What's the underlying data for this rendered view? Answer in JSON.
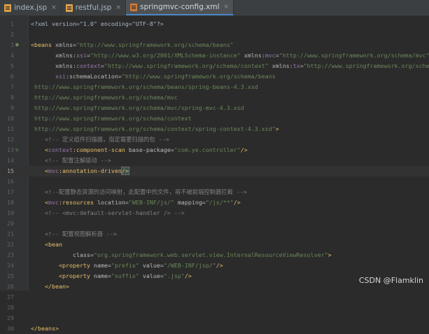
{
  "tabs": [
    {
      "label": "index.jsp",
      "active": false,
      "icon": "jsp-file-icon"
    },
    {
      "label": "restful.jsp",
      "active": false,
      "icon": "jsp-file-icon"
    },
    {
      "label": "springmvc-config.xml",
      "active": true,
      "icon": "xml-file-icon"
    }
  ],
  "close_glyph": "×",
  "current_line": 15,
  "lines": [
    {
      "n": "1",
      "tokens": [
        [
          "t-plain",
          "<?xml version=\"1.0\" encoding=\"UTF-8\"?>"
        ]
      ]
    },
    {
      "n": "2",
      "tokens": []
    },
    {
      "n": "3",
      "mark": "●",
      "tokens": [
        [
          "t-tag",
          "<beans "
        ],
        [
          "t-attr",
          "xmlns="
        ],
        [
          "t-val",
          "\"http://www.springframework.org/schema/beans\""
        ]
      ]
    },
    {
      "n": "4",
      "tokens": [
        [
          "t-plain",
          "       "
        ],
        [
          "t-attr",
          "xmlns:"
        ],
        [
          "t-ns",
          "xsi"
        ],
        [
          "t-attr",
          "="
        ],
        [
          "t-val",
          "\"http://www.w3.org/2001/XMLSchema-instance\""
        ],
        [
          "t-plain",
          " "
        ],
        [
          "t-attr",
          "xmlns:"
        ],
        [
          "t-ns",
          "mvc"
        ],
        [
          "t-attr",
          "="
        ],
        [
          "t-val",
          "\"http://www.springframework.org/schema/mvc\""
        ]
      ]
    },
    {
      "n": "5",
      "tokens": [
        [
          "t-plain",
          "       "
        ],
        [
          "t-attr",
          "xmlns:"
        ],
        [
          "t-ns",
          "context"
        ],
        [
          "t-attr",
          "="
        ],
        [
          "t-val",
          "\"http://www.springframework.org/schema/context\""
        ],
        [
          "t-plain",
          " "
        ],
        [
          "t-attr",
          "xmlns:"
        ],
        [
          "t-ns",
          "tx"
        ],
        [
          "t-attr",
          "="
        ],
        [
          "t-val",
          "\"http://www.springframework.org/schema/tx\""
        ]
      ]
    },
    {
      "n": "6",
      "tokens": [
        [
          "t-plain",
          "       "
        ],
        [
          "t-ns",
          "xsi"
        ],
        [
          "t-attr",
          ":schemaLocation="
        ],
        [
          "t-val",
          "\"http://www.springframework.org/schema/beans"
        ]
      ]
    },
    {
      "n": "7",
      "tokens": [
        [
          "t-val",
          " http://www.springframework.org/schema/beans/spring-beans-4.3.xsd"
        ]
      ]
    },
    {
      "n": "8",
      "tokens": [
        [
          "t-val",
          " http://www.springframework.org/schema/mvc"
        ]
      ]
    },
    {
      "n": "9",
      "tokens": [
        [
          "t-val",
          " http://www.springframework.org/schema/mvc/spring-mvc-4.3.xsd"
        ]
      ]
    },
    {
      "n": "10",
      "tokens": [
        [
          "t-val",
          " http://www.springframework.org/schema/context"
        ]
      ]
    },
    {
      "n": "11",
      "tokens": [
        [
          "t-val",
          " http://www.springframework.org/schema/context/spring-context-4.3.xsd\""
        ],
        [
          "t-tag",
          ">"
        ]
      ]
    },
    {
      "n": "12",
      "tokens": [
        [
          "t-cmt",
          "    <!-- 定义组件扫描器，指定需要扫描的包 -->"
        ]
      ]
    },
    {
      "n": "13",
      "mark": "↻",
      "tokens": [
        [
          "t-plain",
          "    "
        ],
        [
          "t-tag",
          "<"
        ],
        [
          "t-ns",
          "context"
        ],
        [
          "t-tag",
          ":component-scan "
        ],
        [
          "t-attr",
          "base-package="
        ],
        [
          "t-val",
          "\"com.ye.controller\""
        ],
        [
          "t-tag",
          "/>"
        ]
      ]
    },
    {
      "n": "14",
      "tokens": [
        [
          "t-cmt",
          "    <!-- 配置注解驱动 -->"
        ]
      ]
    },
    {
      "n": "15",
      "tokens": [
        [
          "t-plain",
          "    "
        ],
        [
          "t-tag",
          "<"
        ],
        [
          "t-ns",
          "mvc"
        ],
        [
          "t-tag",
          ":annotation-driven"
        ],
        [
          "t-tag hl",
          "/>"
        ]
      ]
    },
    {
      "n": "16",
      "tokens": []
    },
    {
      "n": "17",
      "tokens": [
        [
          "t-cmt",
          "    <!--配置静态资源的访问映射，此配置中的文件，将不被前端控制器拦截 -->"
        ]
      ]
    },
    {
      "n": "18",
      "tokens": [
        [
          "t-plain",
          "    "
        ],
        [
          "t-tag",
          "<"
        ],
        [
          "t-ns",
          "mvc"
        ],
        [
          "t-tag",
          ":resources "
        ],
        [
          "t-attr",
          "location="
        ],
        [
          "t-val",
          "\"WEB-INF/js/\""
        ],
        [
          "t-plain",
          " "
        ],
        [
          "t-attr",
          "mapping="
        ],
        [
          "t-val",
          "\"/js/**\""
        ],
        [
          "t-tag",
          "/>"
        ]
      ]
    },
    {
      "n": "19",
      "tokens": [
        [
          "t-cmt",
          "    <!-- <mvc:default-servlet-handler /> -->"
        ]
      ]
    },
    {
      "n": "20",
      "tokens": []
    },
    {
      "n": "21",
      "tokens": [
        [
          "t-cmt",
          "    <!-- 配置视图解析器 -->"
        ]
      ]
    },
    {
      "n": "22",
      "tokens": [
        [
          "t-plain",
          "    "
        ],
        [
          "t-tag",
          "<bean"
        ]
      ]
    },
    {
      "n": "23",
      "tokens": [
        [
          "t-plain",
          "            "
        ],
        [
          "t-attr",
          "class="
        ],
        [
          "t-val",
          "\"org.springframework.web.servlet.view.InternalResourceViewResolver\""
        ],
        [
          "t-tag",
          ">"
        ]
      ]
    },
    {
      "n": "24",
      "tokens": [
        [
          "t-plain",
          "        "
        ],
        [
          "t-tag",
          "<property "
        ],
        [
          "t-attr",
          "name="
        ],
        [
          "t-val",
          "\"prefix\""
        ],
        [
          "t-plain",
          " "
        ],
        [
          "t-attr",
          "value="
        ],
        [
          "t-val",
          "\"/WEB-INF/jsp/\""
        ],
        [
          "t-tag",
          "/>"
        ]
      ]
    },
    {
      "n": "25",
      "tokens": [
        [
          "t-plain",
          "        "
        ],
        [
          "t-tag",
          "<property "
        ],
        [
          "t-attr",
          "name="
        ],
        [
          "t-val",
          "\"suffix\""
        ],
        [
          "t-plain",
          " "
        ],
        [
          "t-attr",
          "value="
        ],
        [
          "t-val",
          "\".jsp\""
        ],
        [
          "t-tag",
          "/>"
        ]
      ]
    },
    {
      "n": "26",
      "tokens": [
        [
          "t-plain",
          "    "
        ],
        [
          "t-tag",
          "</bean>"
        ]
      ]
    },
    {
      "n": "27",
      "tokens": []
    },
    {
      "n": "28",
      "tokens": []
    },
    {
      "n": "29",
      "tokens": []
    },
    {
      "n": "30",
      "tokens": [
        [
          "t-tag",
          "</beans>"
        ]
      ]
    }
  ],
  "watermark": "CSDN @Flamklin"
}
